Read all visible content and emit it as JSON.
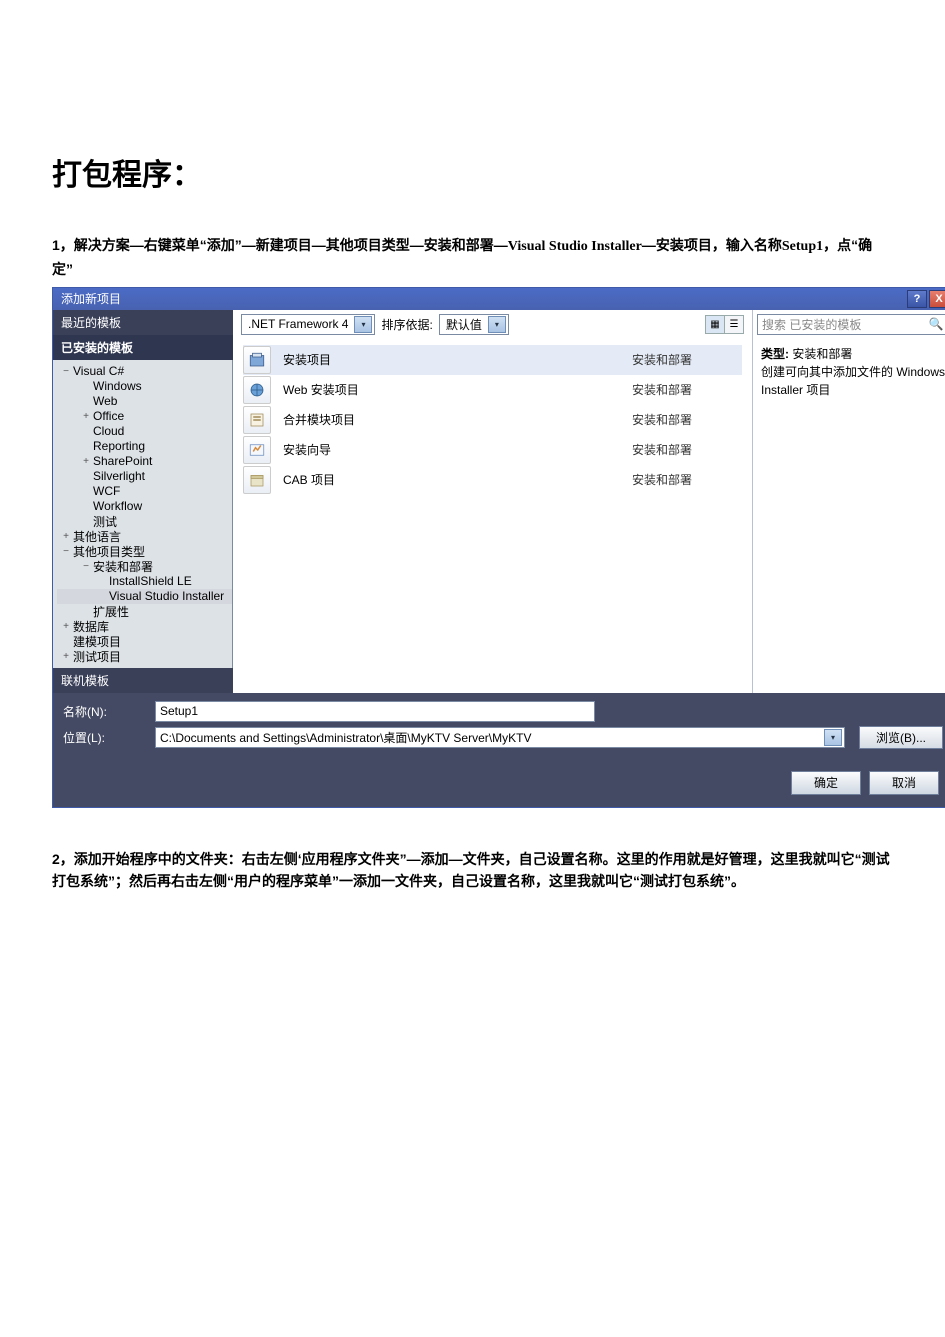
{
  "heading": "打包程序：",
  "step1": {
    "prefix": "1，解决方案—右键菜单“添加”—新建项目—其他项目类型—安装和部署—",
    "installer": "Visual Studio Installer",
    "mid": "—安装项目，输入名称",
    "setup": "Setup1",
    "suffix": "，点“确定”"
  },
  "dialog": {
    "title": "添加新项目",
    "help": "?",
    "close": "X",
    "left": {
      "recent": "最近的模板",
      "installed": "已安装的模板",
      "online": "联机模板"
    },
    "tree": [
      {
        "label": "Visual C#",
        "level": 0,
        "exp": "−"
      },
      {
        "label": "Windows",
        "level": 1,
        "exp": ""
      },
      {
        "label": "Web",
        "level": 1,
        "exp": ""
      },
      {
        "label": "Office",
        "level": 1,
        "exp": "+"
      },
      {
        "label": "Cloud",
        "level": 1,
        "exp": ""
      },
      {
        "label": "Reporting",
        "level": 1,
        "exp": ""
      },
      {
        "label": "SharePoint",
        "level": 1,
        "exp": "+"
      },
      {
        "label": "Silverlight",
        "level": 1,
        "exp": ""
      },
      {
        "label": "WCF",
        "level": 1,
        "exp": ""
      },
      {
        "label": "Workflow",
        "level": 1,
        "exp": ""
      },
      {
        "label": "测试",
        "level": 1,
        "exp": ""
      },
      {
        "label": "其他语言",
        "level": 0,
        "exp": "+"
      },
      {
        "label": "其他项目类型",
        "level": 0,
        "exp": "−"
      },
      {
        "label": "安装和部署",
        "level": 1,
        "exp": "−"
      },
      {
        "label": "InstallShield LE",
        "level": 2,
        "exp": ""
      },
      {
        "label": "Visual Studio Installer",
        "level": 2,
        "exp": "",
        "selected": true
      },
      {
        "label": "扩展性",
        "level": 1,
        "exp": ""
      },
      {
        "label": "数据库",
        "level": 0,
        "exp": "+"
      },
      {
        "label": "建模项目",
        "level": 0,
        "exp": ""
      },
      {
        "label": "测试项目",
        "level": 0,
        "exp": "+"
      }
    ],
    "toolbar": {
      "framework": ".NET Framework 4",
      "sort_label": "排序依据:",
      "sort_value": "默认值"
    },
    "templates": [
      {
        "name": "安装项目",
        "cat": "安装和部署",
        "selected": true
      },
      {
        "name": "Web 安装项目",
        "cat": "安装和部署"
      },
      {
        "name": "合并模块项目",
        "cat": "安装和部署"
      },
      {
        "name": "安装向导",
        "cat": "安装和部署"
      },
      {
        "name": "CAB 项目",
        "cat": "安装和部署"
      }
    ],
    "search_placeholder": "搜索 已安装的模板",
    "desc": {
      "type_label": "类型:",
      "type_value": "安装和部署",
      "text": "创建可向其中添加文件的 Windows Installer 项目"
    },
    "form": {
      "name_label": "名称(N):",
      "name_value": "Setup1",
      "loc_label": "位置(L):",
      "loc_value": "C:\\Documents and Settings\\Administrator\\桌面\\MyKTV Server\\MyKTV",
      "browse": "浏览(B)..."
    },
    "buttons": {
      "ok": "确定",
      "cancel": "取消"
    }
  },
  "step2": {
    "line1a": "2，添加开始程序中的文件夹：右击左侧‘应用程序文件夹”—添加—文件夹，自己设置名称。",
    "line1b": "这里的作用就是好管理，这里我就叫它“测试打包系统”；",
    "line2a": "然后再右击左侧“用户的程序菜单”一添加一文件夹，自己设置名称，这里我就叫它",
    "line2b": "“测试打包系统”。"
  }
}
